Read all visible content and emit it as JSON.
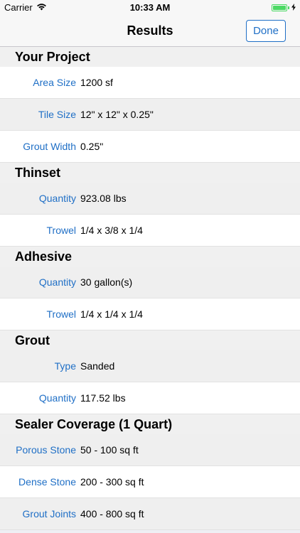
{
  "status_bar": {
    "carrier": "Carrier",
    "time": "10:33 AM",
    "battery_level": 1.0
  },
  "nav": {
    "title": "Results",
    "done_label": "Done"
  },
  "sections": [
    {
      "title": "Your Project",
      "rows": [
        {
          "label": "Area Size",
          "value": "1200 sf"
        },
        {
          "label": "Tile Size",
          "value": "12\" x 12\" x 0.25\""
        },
        {
          "label": "Grout Width",
          "value": "0.25\""
        }
      ]
    },
    {
      "title": "Thinset",
      "rows": [
        {
          "label": "Quantity",
          "value": "923.08 lbs"
        },
        {
          "label": "Trowel",
          "value": "1/4 x 3/8 x 1/4"
        }
      ]
    },
    {
      "title": "Adhesive",
      "rows": [
        {
          "label": "Quantity",
          "value": "30 gallon(s)"
        },
        {
          "label": "Trowel",
          "value": "1/4 x 1/4 x 1/4"
        }
      ]
    },
    {
      "title": "Grout",
      "rows": [
        {
          "label": "Type",
          "value": "Sanded"
        },
        {
          "label": "Quantity",
          "value": "117.52 lbs"
        }
      ]
    },
    {
      "title": "Sealer Coverage (1 Quart)",
      "rows": [
        {
          "label": "Porous Stone",
          "value": "50 - 100 sq ft"
        },
        {
          "label": "Dense Stone",
          "value": "200 - 300 sq ft"
        },
        {
          "label": "Grout Joints",
          "value": "400 - 800 sq ft"
        }
      ]
    }
  ],
  "colors": {
    "accent": "#1f6fc6",
    "battery": "#4cd964"
  }
}
